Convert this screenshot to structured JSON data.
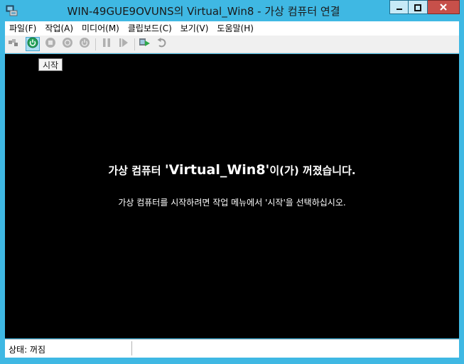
{
  "window": {
    "title": "WIN-49GUE9OVUNS의 Virtual_Win8 - 가상 컴퓨터 연결",
    "icon": "vm-connect-icon"
  },
  "menu": [
    {
      "label": "파일(F)"
    },
    {
      "label": "작업(A)"
    },
    {
      "label": "미디어(M)"
    },
    {
      "label": "클립보드(C)"
    },
    {
      "label": "보기(V)"
    },
    {
      "label": "도움말(H)"
    }
  ],
  "toolbar": {
    "tooltip": "시작",
    "buttons": [
      "ctrl-alt-del-icon",
      "start-icon",
      "turn-off-icon",
      "shutdown-icon",
      "save-icon",
      "pause-icon",
      "reset-icon",
      "checkpoint-icon",
      "revert-icon"
    ]
  },
  "screen": {
    "msg_prefix": "가상 컴퓨터 ",
    "vm_name": "'Virtual_Win8'",
    "msg_suffix": "이(가) 꺼졌습니다.",
    "sub_message": "가상 컴퓨터를 시작하려면 작업 메뉴에서 '시작'을 선택하십시오."
  },
  "status": {
    "text": "상태: 꺼짐"
  },
  "colors": {
    "frame": "#3fb8e3",
    "screen": "#000000",
    "active_button": "#a9ddf3",
    "close_button": "#c7504a"
  }
}
